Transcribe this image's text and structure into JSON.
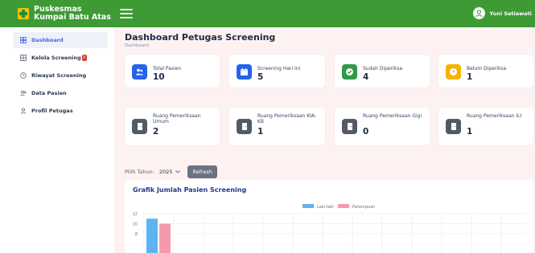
{
  "app": {
    "title_line1": "Puskesmas",
    "title_line2": "Kumpai Batu Atas",
    "user_name": "Yuni Setiawati",
    "brand_color": "#3e9a35"
  },
  "sidebar": {
    "items": [
      {
        "label": "Dashboard",
        "icon": "grid-icon",
        "active": true
      },
      {
        "label": "Kelola Screening",
        "icon": "grid-icon",
        "badge": "!"
      },
      {
        "label": "Riwayat Screening",
        "icon": "clock-icon"
      },
      {
        "label": "Data Pasien",
        "icon": "users-icon"
      },
      {
        "label": "Profil Petugas",
        "icon": "user-icon"
      }
    ]
  },
  "page": {
    "title": "Dashboard Petugas Screening",
    "breadcrumb": "Dashboard"
  },
  "stats": [
    {
      "label": "Total Pasien",
      "value": "10",
      "color": "#2563eb",
      "icon": "users-icon"
    },
    {
      "label": "Screening Hari Ini",
      "value": "5",
      "color": "#2563eb",
      "icon": "calendar-icon"
    },
    {
      "label": "Sudah Diperiksa",
      "value": "4",
      "color": "#2e9a4a",
      "icon": "check-icon"
    },
    {
      "label": "Belum Diperiksa",
      "value": "1",
      "color": "#f5b400",
      "icon": "clock-icon"
    }
  ],
  "rooms": [
    {
      "label": "Ruang Pemeriksaan Umum",
      "value": "2",
      "icon": "door-icon"
    },
    {
      "label": "Ruang Pemeriksaan KIA-KB",
      "value": "1",
      "icon": "door-icon"
    },
    {
      "label": "Ruang Pemeriksaan Gigi",
      "value": "0",
      "icon": "door-icon"
    },
    {
      "label": "Ruang Pemeriksaan ILI",
      "value": "1",
      "icon": "door-icon"
    }
  ],
  "filter": {
    "year_label": "Pilih Tahun:",
    "year_value": "2025",
    "refresh_label": "Refresh"
  },
  "chart_data": {
    "type": "bar",
    "title": "Grafik Jumlah Pasien Screening",
    "series": [
      {
        "name": "Laki-laki",
        "color": "#5fb3f0",
        "values": [
          11
        ]
      },
      {
        "name": "Perempuan",
        "color": "#f59aae",
        "values": [
          10
        ]
      }
    ],
    "y_ticks": [
      "12",
      "10",
      "8"
    ],
    "ylim": [
      8,
      12
    ],
    "legend_position": "top-center",
    "grid": true
  }
}
